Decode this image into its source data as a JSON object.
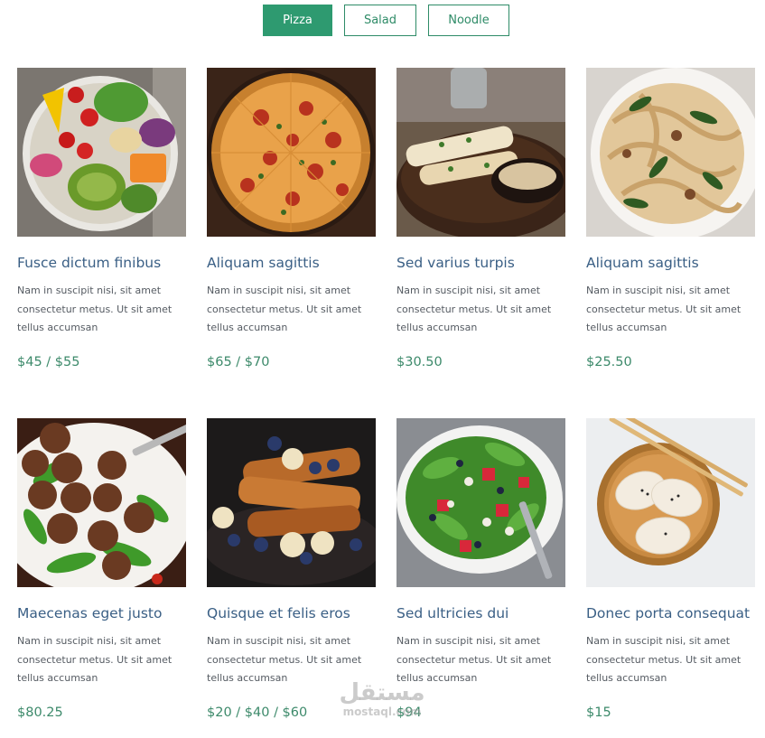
{
  "filters": {
    "tabs": [
      {
        "label": "Pizza",
        "active": true
      },
      {
        "label": "Salad",
        "active": false
      },
      {
        "label": "Noodle",
        "active": false
      }
    ]
  },
  "menu": {
    "items": [
      {
        "image": "salad-bowl",
        "title": "Fusce dictum finibus",
        "description": "Nam in suscipit nisi, sit amet consectetur metus. Ut sit amet tellus accumsan",
        "price": "$45 / $55"
      },
      {
        "image": "pizza",
        "title": "Aliquam sagittis",
        "description": "Nam in suscipit nisi, sit amet consectetur metus. Ut sit amet tellus accumsan",
        "price": "$65 / $70"
      },
      {
        "image": "grilled-dish",
        "title": "Sed varius turpis",
        "description": "Nam in suscipit nisi, sit amet consectetur metus. Ut sit amet tellus accumsan",
        "price": "$30.50"
      },
      {
        "image": "pasta",
        "title": "Aliquam sagittis",
        "description": "Nam in suscipit nisi, sit amet consectetur metus. Ut sit amet tellus accumsan",
        "price": "$25.50"
      },
      {
        "image": "meatballs",
        "title": "Maecenas eget justo",
        "description": "Nam in suscipit nisi, sit amet consectetur metus. Ut sit amet tellus accumsan",
        "price": "$80.25"
      },
      {
        "image": "french-toast",
        "title": "Quisque et felis eros",
        "description": "Nam in suscipit nisi, sit amet consectetur metus. Ut sit amet tellus accumsan",
        "price": "$20 / $40 / $60"
      },
      {
        "image": "fruit-salad",
        "title": "Sed ultricies dui",
        "description": "Nam in suscipit nisi, sit amet consectetur metus. Ut sit amet tellus accumsan",
        "price": "$94"
      },
      {
        "image": "dumplings",
        "title": "Donec porta consequat",
        "description": "Nam in suscipit nisi, sit amet consectetur metus. Ut sit amet tellus accumsan",
        "price": "$15"
      }
    ]
  },
  "watermark": {
    "arabic": "مستقل",
    "latin": "mostaql.com"
  },
  "colors": {
    "accent": "#2e9a70",
    "title": "#3a5f85",
    "price": "#3d8a6b"
  }
}
